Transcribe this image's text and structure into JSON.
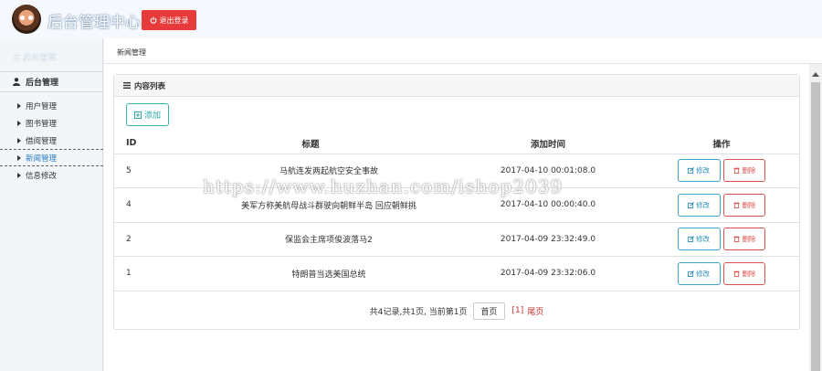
{
  "header": {
    "brand": "后台管理中心",
    "logout_label": "退出登录",
    "logout_icon": "power-icon"
  },
  "sidebar": {
    "faded_label": "后台管理",
    "section_label": "后台管理",
    "section_icon": "user-icon",
    "items": [
      {
        "label": "用户管理"
      },
      {
        "label": "图书管理"
      },
      {
        "label": "借阅管理"
      },
      {
        "label": "新闻管理",
        "active": true
      },
      {
        "label": "信息修改"
      }
    ]
  },
  "breadcrumb": "新闻管理",
  "panel": {
    "title": "内容列表",
    "add_label": "添加"
  },
  "table": {
    "headers": [
      "ID",
      "标题",
      "添加时间",
      "操作"
    ],
    "edit_label": "修改",
    "delete_label": "删除",
    "rows": [
      {
        "id": "5",
        "title": "马航连发两起航空安全事故",
        "time": "2017-04-10 00:01:08.0"
      },
      {
        "id": "4",
        "title": "美军方称美航母战斗群驶向朝鲜半岛 回应朝鲜挑",
        "time": "2017-04-10 00:00:40.0"
      },
      {
        "id": "2",
        "title": "保监会主席项俊波落马2",
        "time": "2017-04-09 23:32:49.0"
      },
      {
        "id": "1",
        "title": "特朗普当选美国总统",
        "time": "2017-04-09 23:32:06.0"
      }
    ]
  },
  "pager": {
    "summary": "共4记录,共1页, 当前第1页",
    "first": "首页",
    "current": "[1]",
    "last": "尾页"
  },
  "watermark": "https://www.huzhan.com/ishop2039",
  "colors": {
    "danger": "#e73a3a",
    "teal": "#3bb5b0",
    "info": "#3aa2c9"
  }
}
